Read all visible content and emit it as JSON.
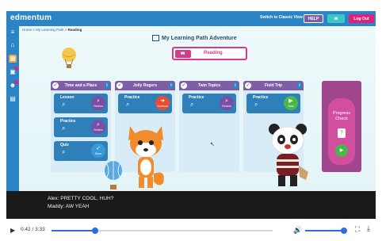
{
  "header": {
    "logo": "edmentum",
    "classic_view": "Switch to Classic View",
    "help": "HELP",
    "mail": "",
    "logout": "Log Out"
  },
  "breadcrumb": {
    "home": "Home",
    "path": "My Learning Path",
    "current": "Reading"
  },
  "learning_path_title": "My Learning Path Adventure",
  "subject": "Reading",
  "columns": [
    {
      "title": "Time and a Place",
      "cards": [
        {
          "label": "Lesson",
          "action": "Review"
        },
        {
          "label": "Practice",
          "action": "Review"
        },
        {
          "label": "Quiz",
          "action": "Done"
        }
      ]
    },
    {
      "title": "Jolly Rogers",
      "cards": [
        {
          "label": "Practice",
          "action": "Continue"
        }
      ]
    },
    {
      "title": "Twin Topics",
      "cards": [
        {
          "label": "Practice",
          "action": "Review"
        }
      ]
    },
    {
      "title": "Field Trip",
      "cards": [
        {
          "label": "Practice",
          "action": "Start"
        }
      ]
    }
  ],
  "progress_check": {
    "label": "Progress Check",
    "action": "Start"
  },
  "captions": [
    "Alex: PRETTY COOL, HUH?",
    "Maddy: AW YEAH"
  ],
  "video": {
    "time_current": "0:42",
    "time_total": "3:33",
    "time_readout": "0:42 / 3:33",
    "progress_fraction": 0.197,
    "volume_fraction": 0.9
  },
  "colors": {
    "header_blue": "#2a84c6",
    "column_purple": "#7f5ea6",
    "subject_pink": "#d43c8b",
    "progress_magenta": "#a0468e",
    "seek_blue": "#2a6fdb"
  },
  "icons": {
    "menu": "menu-icon",
    "home": "home-icon",
    "map": "map-icon",
    "calendar": "calendar-icon",
    "people": "people-icon",
    "document": "document-icon",
    "play": "play-icon",
    "volume": "volume-icon",
    "fullscreen": "fullscreen-icon",
    "download": "download-icon"
  }
}
